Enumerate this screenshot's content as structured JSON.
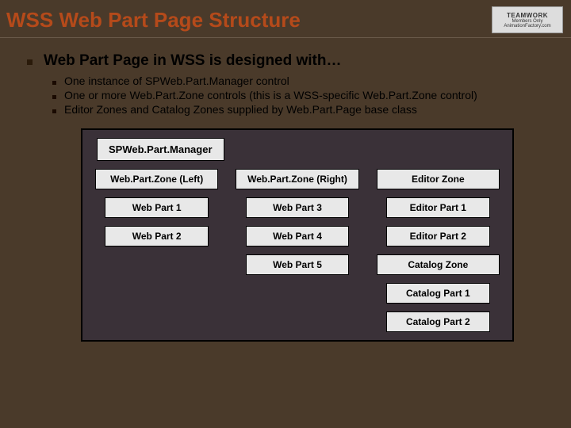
{
  "title": "WSS Web Part Page Structure",
  "logo": {
    "brand": "TEAMWORK",
    "sub": "Members Only AnimationFactory.com"
  },
  "bullet_main": "Web Part Page in WSS is designed with…",
  "sub_bullets": [
    "One instance of SPWeb.Part.Manager control",
    "One or more Web.Part.Zone controls (this is a WSS-specific Web.Part.Zone control)",
    "Editor Zones and Catalog Zones supplied by Web.Part.Page base class"
  ],
  "diagram": {
    "manager": "SPWeb.Part.Manager",
    "columns": [
      {
        "header": "Web.Part.Zone (Left)",
        "parts": [
          "Web Part 1",
          "Web Part 2"
        ]
      },
      {
        "header": "Web.Part.Zone (Right)",
        "parts": [
          "Web Part 3",
          "Web Part 4",
          "Web Part 5"
        ]
      },
      {
        "header": "Editor Zone",
        "parts": [
          "Editor Part 1",
          "Editor Part 2"
        ],
        "header2": "Catalog Zone",
        "parts2": [
          "Catalog Part 1",
          "Catalog Part 2"
        ]
      }
    ]
  }
}
